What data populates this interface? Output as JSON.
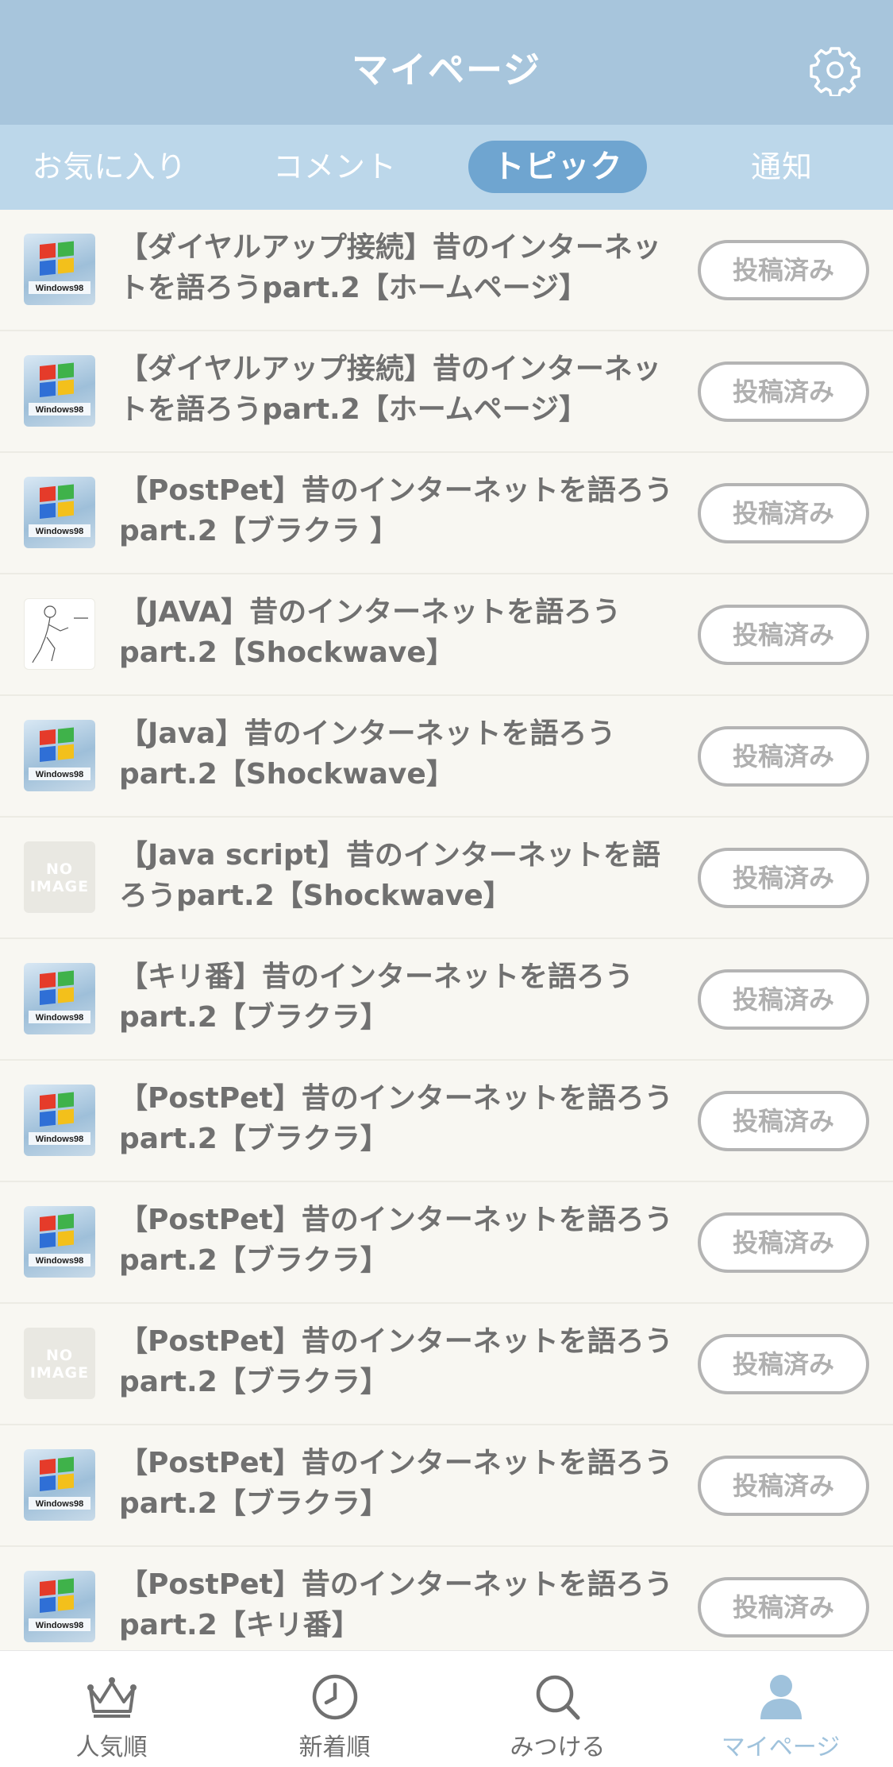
{
  "header": {
    "title": "マイページ",
    "settings_icon": "gear-icon"
  },
  "tabs": [
    {
      "label": "お気に入り",
      "active": false
    },
    {
      "label": "コメント",
      "active": false
    },
    {
      "label": "トピック",
      "active": true
    },
    {
      "label": "通知",
      "active": false
    }
  ],
  "topics": [
    {
      "thumb": "windows98",
      "title": "【ダイヤルアップ接続】昔のインターネッ\nトを語ろうpart.2【ホームページ】",
      "status": "投稿済み"
    },
    {
      "thumb": "windows98",
      "title": "【ダイヤルアップ接続】昔のインターネッ\nトを語ろうpart.2【ホームページ】",
      "status": "投稿済み"
    },
    {
      "thumb": "windows98",
      "title": "【PostPet】昔のインターネットを語ろう\npart.2【ブラクラ 】",
      "status": "投稿済み"
    },
    {
      "thumb": "sketch",
      "title": "【JAVA】昔のインターネットを語ろう\npart.2【Shockwave】",
      "status": "投稿済み"
    },
    {
      "thumb": "windows98",
      "title": "【Java】昔のインターネットを語ろう\npart.2【Shockwave】",
      "status": "投稿済み"
    },
    {
      "thumb": "noimage",
      "title": "【Java script】昔のインターネットを語\nろうpart.2【Shockwave】",
      "status": "投稿済み"
    },
    {
      "thumb": "windows98",
      "title": "【キリ番】昔のインターネットを語ろう\npart.2【ブラクラ】",
      "status": "投稿済み"
    },
    {
      "thumb": "windows98",
      "title": "【PostPet】昔のインターネットを語ろう\npart.2【ブラクラ】",
      "status": "投稿済み"
    },
    {
      "thumb": "windows98",
      "title": "【PostPet】昔のインターネットを語ろう\npart.2【ブラクラ】",
      "status": "投稿済み"
    },
    {
      "thumb": "noimage",
      "title": "【PostPet】昔のインターネットを語ろう\npart.2【ブラクラ】",
      "status": "投稿済み"
    },
    {
      "thumb": "windows98",
      "title": "【PostPet】昔のインターネットを語ろう\npart.2【ブラクラ】",
      "status": "投稿済み"
    },
    {
      "thumb": "windows98",
      "title": "【PostPet】昔のインターネットを語ろう\npart.2【キリ番】",
      "status": "投稿済み"
    }
  ],
  "thumb_texts": {
    "windows_label": "Windows98",
    "no_image": "NO\nIMAGE"
  },
  "tabbar": [
    {
      "label": "人気順",
      "icon": "crown-icon",
      "active": false
    },
    {
      "label": "新着順",
      "icon": "clock-icon",
      "active": false
    },
    {
      "label": "みつける",
      "icon": "search-icon",
      "active": false
    },
    {
      "label": "マイページ",
      "icon": "person-icon",
      "active": true
    }
  ],
  "colors": {
    "header_bg": "#a7c5dc",
    "tabs_bg": "#bcd7ea",
    "active_tab_bg": "#6fa5d0",
    "list_bg": "#f8f7f2",
    "active_tabbar": "#9fc2dc"
  }
}
